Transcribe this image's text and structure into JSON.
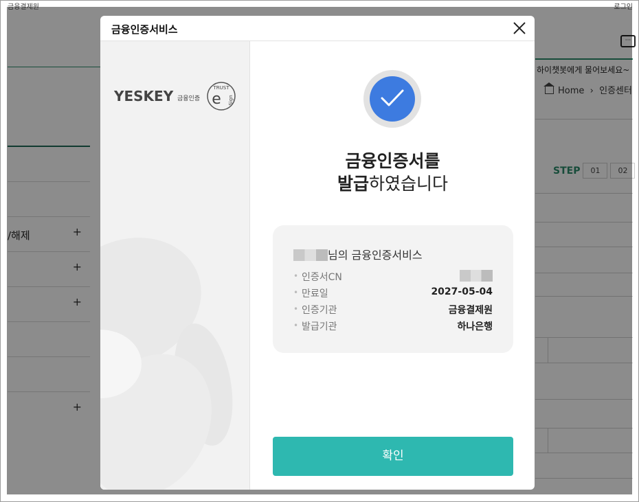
{
  "background": {
    "top_left_text": "금융결제원",
    "top_right_text": "로그인",
    "chat_text": "하이챗봇에게 물어보세요~",
    "breadcrumb": [
      "Home",
      "인증센터"
    ],
    "step_label": "STEP",
    "steps": [
      "01",
      "02"
    ],
    "sidebar_items": [
      {
        "label": "",
        "plus": ""
      },
      {
        "label": "",
        "plus": ""
      },
      {
        "label": "/해제",
        "plus": "+"
      },
      {
        "label": "",
        "plus": "+"
      },
      {
        "label": "",
        "plus": "+"
      },
      {
        "label": "",
        "plus": ""
      },
      {
        "label": "",
        "plus": ""
      },
      {
        "label": "",
        "plus": "+"
      }
    ]
  },
  "modal": {
    "title": "금융인증서비스",
    "logo": {
      "brand": "YESKEY",
      "sub": "금융인증",
      "badge_top": "TRUST",
      "badge_bottom": "Sign"
    },
    "headline_bold_1": "금융인증서를",
    "headline_bold_2": "발급",
    "headline_normal_2": "하였습니다",
    "owner_suffix": "님의 금융인증서비스",
    "details": [
      {
        "key": "인증서CN",
        "value": ""
      },
      {
        "key": "만료일",
        "value": "2027-05-04"
      },
      {
        "key": "인증기관",
        "value": "금융결제원"
      },
      {
        "key": "발급기관",
        "value": "하나은행"
      }
    ],
    "confirm_label": "확인"
  },
  "colors": {
    "accent_blue": "#3d7be0",
    "button_teal": "#2eb8b0",
    "brand_green": "#2a8a6a"
  }
}
